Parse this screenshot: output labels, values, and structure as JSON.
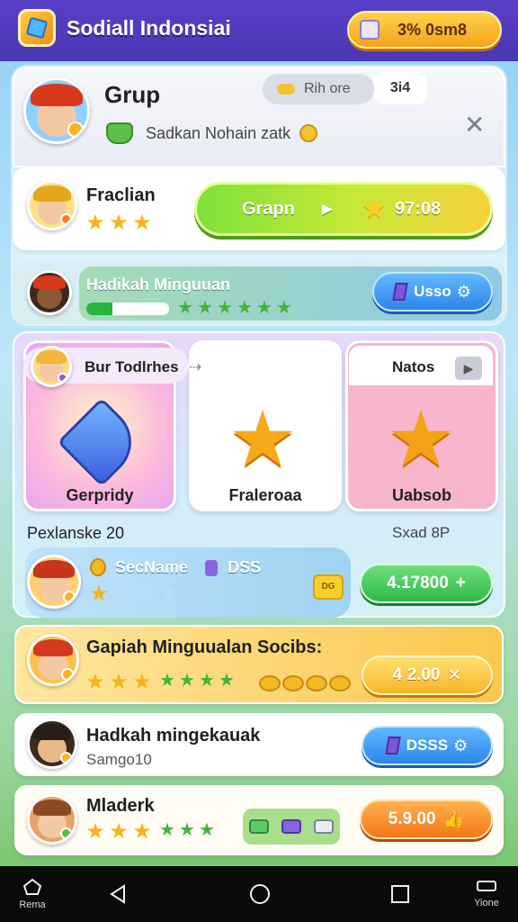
{
  "header": {
    "app_title": "Sodiall Indonsiai",
    "currency_text": "3% 0sm8",
    "logo_icon": "cube-logo-icon"
  },
  "group": {
    "title": "Grup",
    "subtitle": "Sadkan Nohain zatk",
    "search_chip": "Rih ore",
    "count_chip": "3i4",
    "close_icon": "close-icon"
  },
  "leader_row": {
    "name": "Fraclian",
    "stars_filled": 3,
    "stars_total": 3,
    "button_label": "Grapn",
    "button_value": "97:08"
  },
  "progress_row": {
    "title": "Hadikah Minguuan",
    "progress": 0.32,
    "green_stars": 6,
    "button_label": "Usso"
  },
  "rewards": {
    "tab_label": "Bur Todlrhes",
    "right_header": "Natos",
    "cards": [
      {
        "label": "Gerpridy",
        "icon": "kite-crystal-icon"
      },
      {
        "label": "Fraleroaa",
        "icon": "smiling-star-icon"
      },
      {
        "label": "Uabsob",
        "icon": "golden-star-badge-icon"
      }
    ],
    "left_caption": "Pexlanske 20",
    "right_caption": "Sxad 8P",
    "player_name": "SecName",
    "player_tag": "DSS",
    "player_stars_filled": 1,
    "player_stars_total": 4,
    "ticket_label": "DG",
    "claim_value": "4.17800",
    "claim_icon": "+"
  },
  "list": [
    {
      "title": "Gapiah Minguualan Socibs:",
      "subtitle": "",
      "button_value": "4 2.00",
      "button_icon": "✕"
    },
    {
      "title": "Hadkah mingekauak",
      "subtitle": "Samgo10",
      "button_value": "DSSS"
    },
    {
      "title": "Mladerk",
      "subtitle": "",
      "button_value": "5.9.00",
      "button_icon": "👍"
    }
  ],
  "navbar": {
    "items": [
      {
        "label": "Rema",
        "icon": "home-outline-icon"
      },
      {
        "label": "",
        "icon": "back-triangle-icon"
      },
      {
        "label": "",
        "icon": "home-circle-icon"
      },
      {
        "label": "",
        "icon": "recents-square-icon"
      },
      {
        "label": "Yione",
        "icon": "menu-icon"
      }
    ]
  },
  "colors": {
    "header": "#4a36b2",
    "green_button": "#7ee23a",
    "blue_button": "#2b86ea",
    "orange_button": "#f2771c",
    "gold": "#f7b318"
  }
}
